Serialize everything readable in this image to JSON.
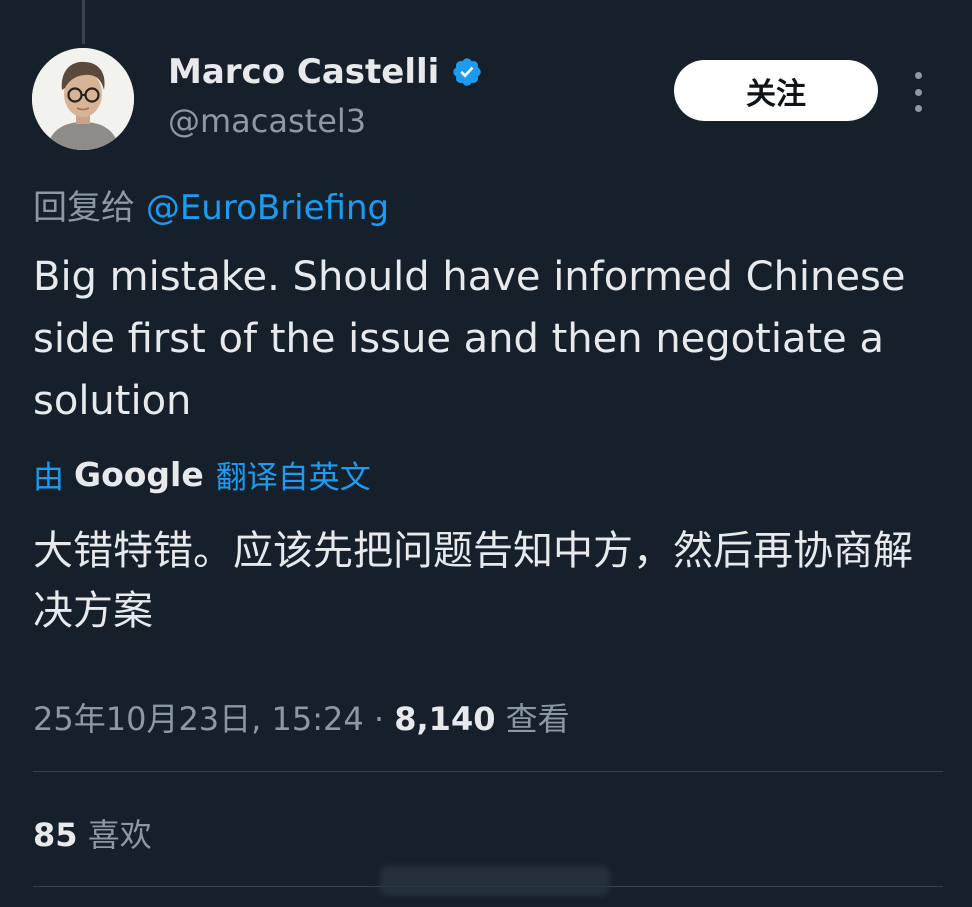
{
  "author": {
    "display_name": "Marco Castelli",
    "handle": "@macastel3",
    "verified": true,
    "verified_color": "#1d9bf0"
  },
  "follow_button": {
    "label": "关注"
  },
  "more_menu": {
    "icon": "more-vertical-icon"
  },
  "reply": {
    "prefix": "回复给",
    "mention": "@EuroBriefing"
  },
  "tweet": {
    "text": "Big mistake. Should have informed Chinese side first of the issue and then negotiate a solution"
  },
  "translation": {
    "by_label": "由",
    "provider": "Google",
    "action_label": "翻译自英文",
    "text": "大错特错。应该先把问题告知中方，然后再协商解决方案"
  },
  "meta": {
    "timestamp": "25年10月23日, 15:24",
    "separator": "·",
    "views_count": "8,140",
    "views_label": "查看"
  },
  "stats": {
    "likes_count": "85",
    "likes_label": "喜欢"
  },
  "colors": {
    "background": "#15202b",
    "link": "#1d9bf0",
    "primary_text": "#e7e9ea",
    "secondary_text": "#8b98a5",
    "divider": "#38444d"
  }
}
